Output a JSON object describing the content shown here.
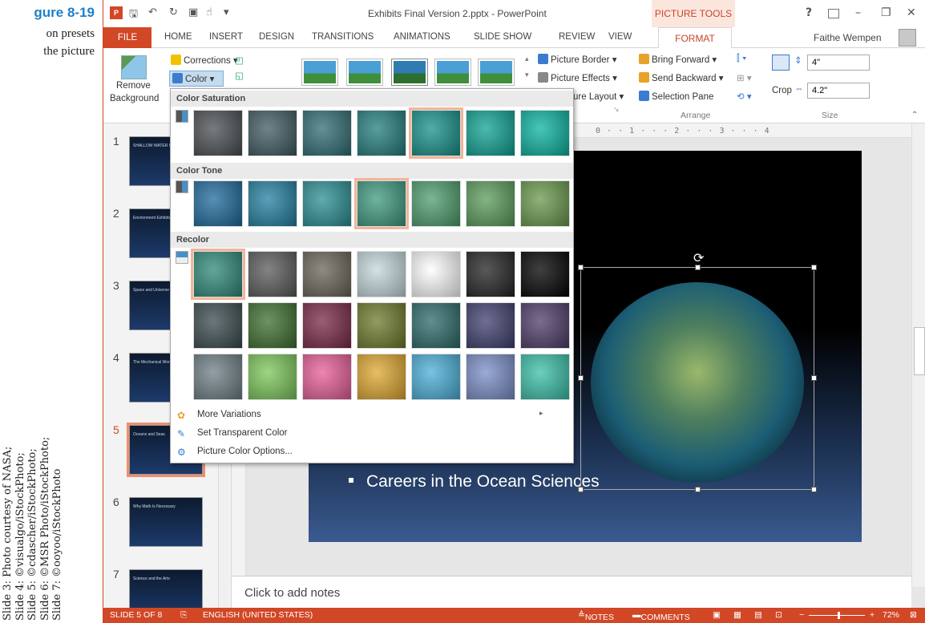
{
  "book": {
    "figure_label": "gure 8-19",
    "caption_lines": [
      "on presets",
      "the picture"
    ],
    "credits": [
      "Slide 3: Photo courtesy of NASA;",
      "Slide 4: ©visualgo/iStockPhoto;",
      "Slide 5: ©cdascher/iStockPhoto;",
      "Slide 6: ©MSR Photo/iStockPhoto;",
      "Slide 7: ©ooyoo/iStockPhoto"
    ]
  },
  "titlebar": {
    "app_icon_text": "P",
    "window_title": "Exhibits Final Version 2.pptx - PowerPoint",
    "context_tab_group": "PICTURE TOOLS",
    "help": "?",
    "minimize": "–",
    "restore": "❐",
    "close": "✕"
  },
  "tabs": {
    "file": "FILE",
    "items": [
      "HOME",
      "INSERT",
      "DESIGN",
      "TRANSITIONS",
      "ANIMATIONS",
      "SLIDE SHOW",
      "REVIEW",
      "VIEW"
    ],
    "format": "FORMAT",
    "user": "Faithe Wempen"
  },
  "ribbon": {
    "remove_background_1": "Remove",
    "remove_background_2": "Background",
    "corrections": "Corrections",
    "color": "Color",
    "picture_border": "Picture Border",
    "picture_effects": "Picture Effects",
    "picture_layout": "ure Layout",
    "bring_forward": "Bring Forward",
    "send_backward": "Send Backward",
    "selection_pane": "Selection Pane",
    "arrange_group": "Arrange",
    "crop": "Crop",
    "height": "4\"",
    "width": "4.2\"",
    "size_group": "Size"
  },
  "dropdown": {
    "color_saturation": "Color Saturation",
    "color_tone": "Color Tone",
    "recolor": "Recolor",
    "more_variations": "More Variations",
    "set_transparent": "Set Transparent Color",
    "picture_color_options": "Picture Color Options...",
    "saturation_colors": [
      "#4a4f52",
      "#3f5a61",
      "#2f6d74",
      "#237e7e",
      "#17918b",
      "#0fa394",
      "#0ab4a0"
    ],
    "saturation_selected": 4,
    "tone_colors": [
      "#1d6a9c",
      "#2280a0",
      "#2a8f94",
      "#3d9a7f",
      "#4e9d6c",
      "#5c9c5b",
      "#69994c"
    ],
    "tone_selected": 3,
    "recolor_rows": [
      [
        "#2e8a7a",
        "#5a5a5a",
        "#6b6457",
        "#c5d8de",
        "#ffffff",
        "#222222",
        "#000000"
      ],
      [
        "#3a4a4e",
        "#3e6e2e",
        "#7a2846",
        "#6e7a2a",
        "#2c6a6a",
        "#3e3f6e",
        "#4e3c68"
      ],
      [
        "#6f7f86",
        "#7cc85a",
        "#e85e98",
        "#e0a830",
        "#4ab0d8",
        "#7a8ec8",
        "#3ac0a8"
      ]
    ],
    "recolor_selected": 0
  },
  "slides": [
    {
      "num": "1",
      "title": "SHALLOW WATER OCEAN"
    },
    {
      "num": "2",
      "title": "Environment Exhibits"
    },
    {
      "num": "3",
      "title": "Space and Universe"
    },
    {
      "num": "4",
      "title": "The Mechanical World"
    },
    {
      "num": "5",
      "title": "Oceans and Seas"
    },
    {
      "num": "6",
      "title": "Why Math Is Necessary"
    },
    {
      "num": "7",
      "title": "Science and the Arts"
    }
  ],
  "selected_slide": 4,
  "slide": {
    "bullet": "Careers in the Ocean Sciences"
  },
  "ruler": "0 · · 1 · · · 2 · · · 3 · · · 4",
  "notes": {
    "placeholder": "Click to add notes"
  },
  "status": {
    "slide_of": "SLIDE 5 OF 8",
    "language": "ENGLISH (UNITED STATES)",
    "notes": "NOTES",
    "comments": "COMMENTS",
    "zoom": "72%"
  }
}
